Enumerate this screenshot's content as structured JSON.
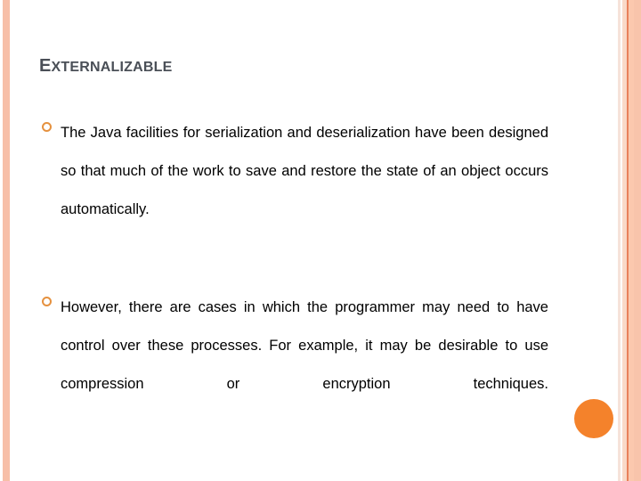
{
  "slide": {
    "title": {
      "full": "EXTERNALIZABLE",
      "first_letter": "E",
      "rest": "XTERNALIZABLE"
    },
    "bullets": [
      {
        "bullet_icon": "circle-ring-bullet",
        "text": "The Java facilities for serialization and deserialization have been designed so that much of the work to save and restore the state of an object occurs automatically."
      },
      {
        "bullet_icon": "circle-ring-bullet",
        "text": " However, there are cases in which the programmer may need to have control over these processes. For example, it may be desirable to use compression or encryption techniques."
      }
    ],
    "decorations": {
      "orange_dot": "orange-circle-decoration",
      "left_stripe": "left-accent-stripe",
      "right_stripes": "right-accent-stripes"
    },
    "colors": {
      "title_text": "#4a4f57",
      "body_text": "#000000",
      "bullet": "#e5913f",
      "orange_dot": "#f4822b",
      "stripe_peach": "#f7bfa8",
      "stripe_dark": "#e8815c",
      "background": "#ffffff"
    }
  }
}
